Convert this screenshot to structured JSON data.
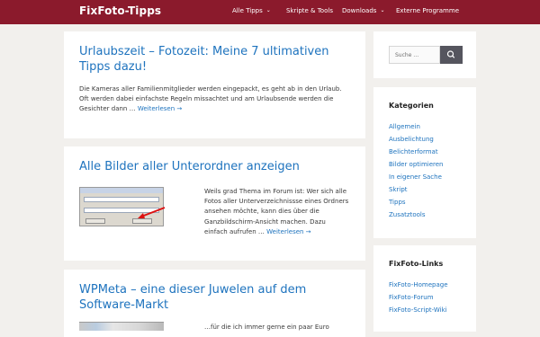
{
  "header": {
    "site_title": "FixFoto-Tipps",
    "nav": [
      {
        "label": "Alle Tipps",
        "caret": "⌄"
      },
      {
        "label": "Skripte & Tools",
        "caret": ""
      },
      {
        "label": "Downloads",
        "caret": "⌄"
      },
      {
        "label": "Externe Programme",
        "caret": ""
      }
    ]
  },
  "posts": [
    {
      "title_line1": "Urlaubszeit – Fotozeit: Meine 7 ultimativen",
      "title_line2": "Tipps dazu!",
      "excerpt_line1": "Die Kameras aller Familienmitglieder werden eingepackt, es geht ab in den Urlaub.",
      "excerpt_line2": "Oft werden dabei einfachste Regeln missachtet und am Urlaubsende werden die",
      "excerpt_line3": "Gesichter dann …",
      "more": "Weiterlesen →"
    },
    {
      "title_line1": "Alle Bilder aller Unterordner anzeigen",
      "excerpt_line1": "Weils grad Thema im Forum ist: Wer sich alle",
      "excerpt_line2": "Fotos aller Unterverzeichnissse eines Ordners",
      "excerpt_line3": "ansehen möchte, kann dies über die",
      "excerpt_line4": "Ganzbildschirm-Ansicht machen. Dazu",
      "excerpt_line5": "einfach aufrufen …",
      "more": "Weiterlesen →"
    },
    {
      "title_line1": "WPMeta – eine dieser Juwelen auf dem",
      "title_line2": "Software-Markt",
      "excerpt_line1": "…für die ich immer gerne ein paar Euro"
    }
  ],
  "sidebar": {
    "search": {
      "placeholder": "Suche …",
      "icon": "search-icon"
    },
    "categories": {
      "title": "Kategorien",
      "items": [
        "Allgemein",
        "Ausbelichtung",
        "Belichterformat",
        "Bilder optimieren",
        "In eigener Sache",
        "Skript",
        "Tipps",
        "Zusatztools"
      ]
    },
    "links": {
      "title": "FixFoto-Links",
      "items": [
        "FixFoto-Homepage",
        "FixFoto-Forum",
        "FixFoto-Script-Wiki"
      ]
    }
  },
  "colors": {
    "header_bg": "#8b1a2c",
    "link": "#1e73be",
    "page_bg": "#f2f0ed"
  }
}
